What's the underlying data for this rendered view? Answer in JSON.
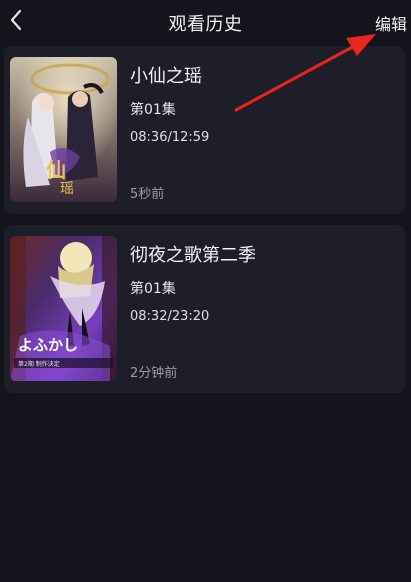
{
  "header": {
    "title": "观看历史",
    "edit_label": "编辑"
  },
  "history": [
    {
      "title": "小仙之瑶",
      "episode": "第01集",
      "progress": "08:36/12:59",
      "time_ago": "5秒前"
    },
    {
      "title": "彻夜之歌第二季",
      "episode": "第01集",
      "progress": "08:32/23:20",
      "time_ago": "2分钟前"
    }
  ],
  "colors": {
    "background": "#13141c",
    "card": "#1d1e29",
    "annotation_arrow": "#e8261e"
  }
}
